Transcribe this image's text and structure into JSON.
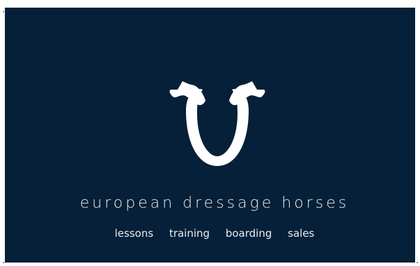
{
  "brand": {
    "name": "european dressage horses",
    "logo_icon": "dressage-horseshoe-logo-icon"
  },
  "services": [
    "lessons",
    "training",
    "boarding",
    "sales"
  ],
  "colors": {
    "background": "#052038",
    "foreground": "#ffffff",
    "page_margin": "#ffffff"
  }
}
